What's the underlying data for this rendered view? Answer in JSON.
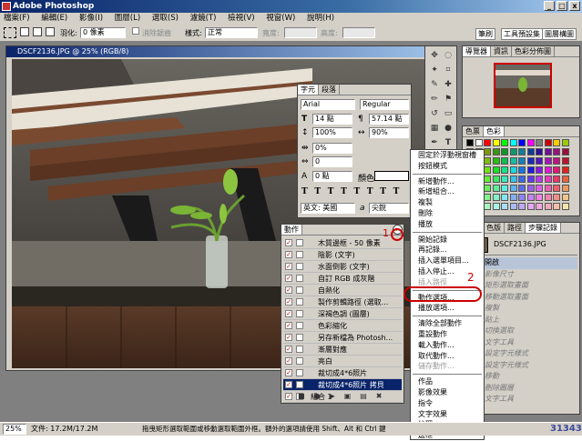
{
  "window": {
    "title": "Adobe Photoshop",
    "min": "_",
    "max": "□",
    "close": "x"
  },
  "menubar": [
    "檔案(F)",
    "編輯(E)",
    "影像(I)",
    "圖層(L)",
    "選取(S)",
    "濾鏡(T)",
    "檢視(V)",
    "視窗(W)",
    "說明(H)"
  ],
  "options": {
    "feather_label": "羽化:",
    "feather_value": "0 像素",
    "antialias": "消除鋸齒",
    "style_label": "樣式:",
    "style_value": "正常",
    "width_label": "寬度:",
    "height_label": "高度:"
  },
  "palette_well": [
    "筆刷",
    "工具預設集",
    "圖層構圖"
  ],
  "document": {
    "title": "DSCF2136.JPG @ 25% (RGB/8)"
  },
  "navigator": {
    "tabs": [
      "導覽器",
      "資訊",
      "色彩分佈圖"
    ]
  },
  "color_panel": {
    "tabs": [
      "色票",
      "色彩"
    ]
  },
  "layers_panel": {
    "tabs": [
      "圖層",
      "色版",
      "路徑",
      "步驟記錄"
    ],
    "snapshot": "DSCF2136.JPG",
    "history": [
      "開啟",
      "影像尺寸",
      "矩形選取畫面",
      "移動選取畫面",
      "複製",
      "貼上",
      "切換選取",
      "文字工具",
      "設定字元樣式",
      "設定字元樣式",
      "移動",
      "刪除圖層",
      "文字工具"
    ]
  },
  "character": {
    "tabs": [
      "字元",
      "段落"
    ],
    "font": "Arial",
    "style": "Regular",
    "size": "14 點",
    "leading": "57.14 點",
    "vscale": "100%",
    "hscale": "90%",
    "kerning": "0%",
    "tracking": "0",
    "baseline": "0 點",
    "color_label": "顏色:",
    "language": "英文: 美國",
    "aa": "a",
    "aa_value": "尖銳"
  },
  "actions": {
    "tab": "動作",
    "rows": [
      "木質邊框 - 50 像素",
      "陰影 (文字)",
      "水面倒影 (文字)",
      "自訂 RGB 成灰階",
      "自熱化",
      "製作剪輯路徑 (選取...",
      "深褐色調 (圖層)",
      "色彩縮化",
      "另存新檔為 Photosh...",
      "漸層對應",
      "亮白",
      "裁切成4*6照片",
      "裁切成4*6照片 拷貝",
      "組合 1"
    ]
  },
  "menu": {
    "sections": [
      [
        "固定於浮動視窗槽",
        "按鈕模式"
      ],
      [
        "新增動作...",
        "新增組合...",
        "複製",
        "刪除",
        "播放"
      ],
      [
        "開始記錄",
        "再記錄...",
        "插入選單項目...",
        "插入停止...",
        "插入路徑"
      ],
      [
        "動作選項...",
        "播放選項..."
      ],
      [
        "清除全部動作",
        "重設動作",
        "載入動作...",
        "取代動作...",
        "儲存動作..."
      ],
      [
        "作品",
        "影像效果",
        "指令",
        "文字效果",
        "紋理",
        "邊框"
      ]
    ],
    "disabled": [
      "插入路徑",
      "儲存動作..."
    ]
  },
  "annotations": {
    "one": "1",
    "two": "2"
  },
  "status": {
    "zoom": "25%",
    "doc": "文件: 17.2M/17.2M",
    "hint": "拖曳矩形選取範圍或移動選取範圍外框。額外的選項請使用 Shift、Alt 和 Ctrl 鍵",
    "watermark": "31343"
  }
}
